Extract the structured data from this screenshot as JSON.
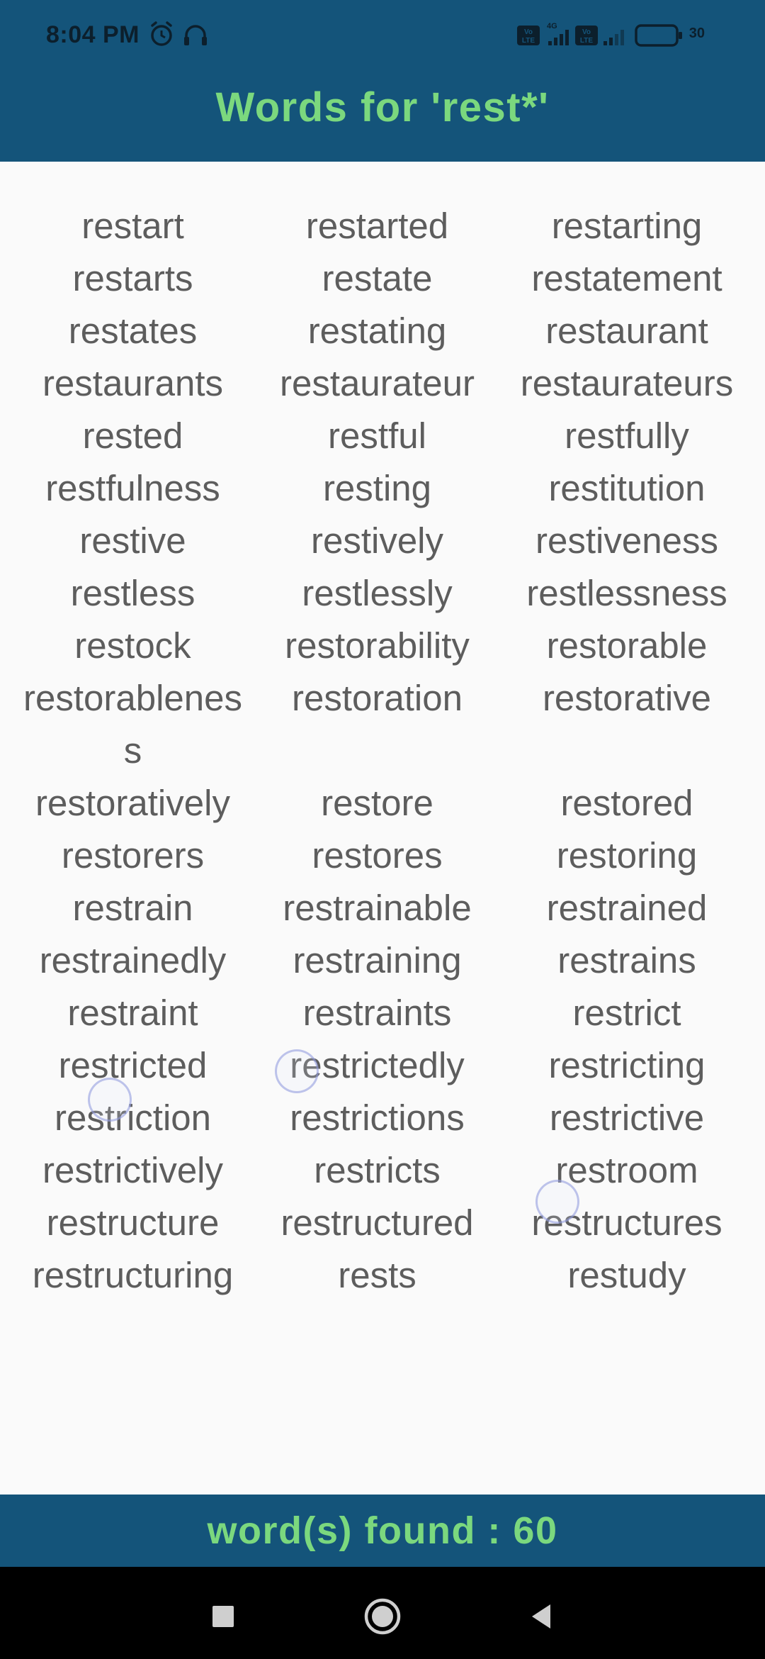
{
  "status_bar": {
    "time": "8:04 PM",
    "battery": "30",
    "left_icons": [
      "alarm-icon",
      "headset-icon"
    ],
    "right_icons": [
      "volte-icon",
      "4g-signal-icon",
      "volte-icon",
      "signal-icon",
      "battery-icon"
    ]
  },
  "header": {
    "title": "Words for 'rest*'"
  },
  "words": [
    "restart",
    "restarted",
    "restarting",
    "restarts",
    "restate",
    "restatement",
    "restates",
    "restating",
    "restaurant",
    "restaurants",
    "restaurateur",
    "restaurateurs",
    "rested",
    "restful",
    "restfully",
    "restfulness",
    "resting",
    "restitution",
    "restive",
    "restively",
    "restiveness",
    "restless",
    "restlessly",
    "restlessness",
    "restock",
    "restorability",
    "restorable",
    "restorableness",
    "restoration",
    "restorative",
    "restoratively",
    "restore",
    "restored",
    "restorers",
    "restores",
    "restoring",
    "restrain",
    "restrainable",
    "restrained",
    "restrainedly",
    "restraining",
    "restrains",
    "restraint",
    "restraints",
    "restrict",
    "restricted",
    "restrictedly",
    "restricting",
    "restriction",
    "restrictions",
    "restrictive",
    "restrictively",
    "restricts",
    "restroom",
    "restructure",
    "restructured",
    "restructures",
    "restructuring",
    "rests",
    "restudy"
  ],
  "footer": {
    "text": "word(s) found : 60"
  },
  "nav": [
    "recents-button",
    "home-button",
    "back-button"
  ],
  "colors": {
    "header_bg": "#14547a",
    "accent_text": "#7bd87e",
    "word_text": "#5d5d5d",
    "page_bg": "#fafafa"
  }
}
